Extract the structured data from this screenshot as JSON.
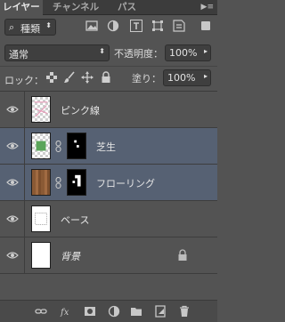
{
  "tabs": [
    {
      "label": "レイヤー",
      "active": true
    },
    {
      "label": "チャンネル",
      "active": false
    },
    {
      "label": "パス",
      "active": false
    }
  ],
  "filter": {
    "kind_label": "種類",
    "filter_icons": [
      "image-filter-icon",
      "adjustment-filter-icon",
      "type-filter-icon",
      "shape-filter-icon",
      "smart-object-filter-icon"
    ]
  },
  "blend": {
    "mode": "通常",
    "opacity_label": "不透明度：",
    "opacity_value": "100%"
  },
  "lock": {
    "label": "ロック：",
    "fill_label": "塗り：",
    "fill_value": "100%"
  },
  "layers": [
    {
      "name": "ピンク線",
      "visible": true,
      "selected": false,
      "has_mask": false
    },
    {
      "name": "芝生",
      "visible": true,
      "selected": true,
      "has_mask": true
    },
    {
      "name": "フローリング",
      "visible": true,
      "selected": true,
      "has_mask": true
    },
    {
      "name": "ベース",
      "visible": true,
      "selected": false,
      "has_mask": false
    },
    {
      "name": "背景",
      "visible": true,
      "selected": false,
      "has_mask": false,
      "locked": true
    }
  ],
  "colors": {
    "panel": "#535353",
    "selected_row": "#566173",
    "tab_bar": "#3c3c3c"
  }
}
